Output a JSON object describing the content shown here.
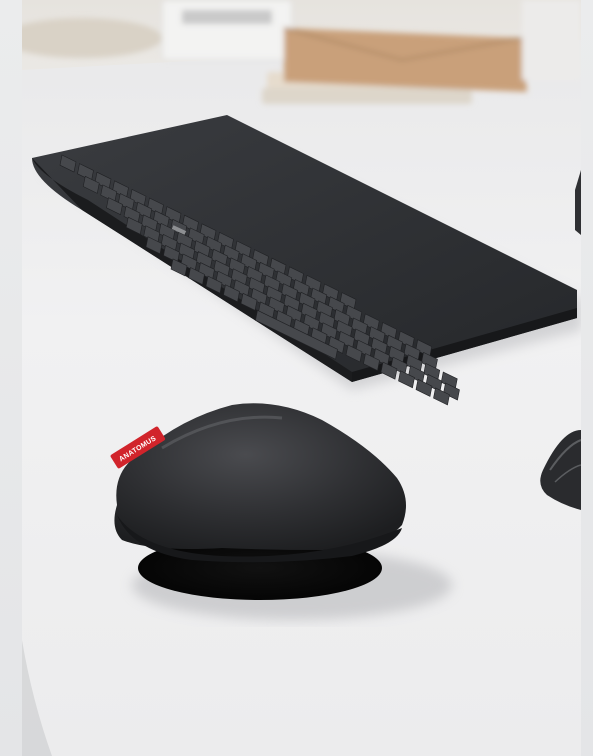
{
  "photo": {
    "subject": "ergonomic-wrist-rest-with-keyboard",
    "brand_tag_text": "ANATOMUS"
  },
  "colors": {
    "desk": "#f0f0f0",
    "keyboard": "#2b2d30",
    "wrist_rest": "#2f3033",
    "tag": "#d1242b",
    "background_wall": "#e9e7e3"
  }
}
